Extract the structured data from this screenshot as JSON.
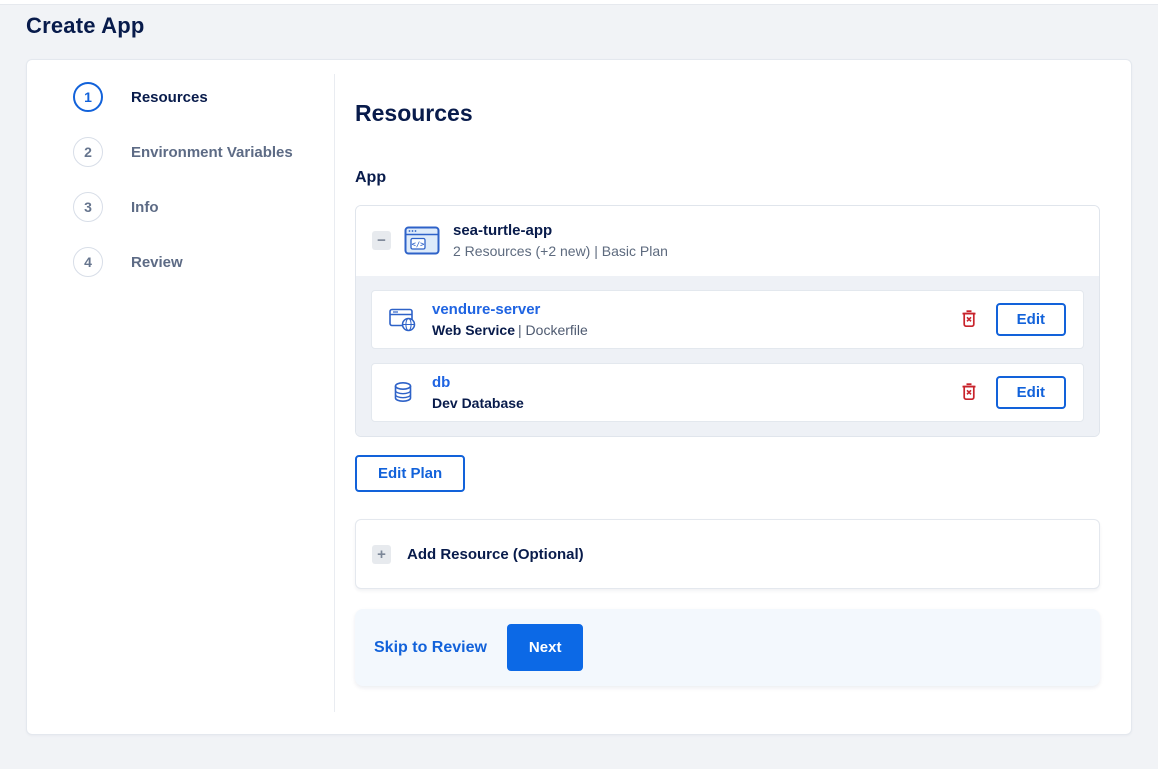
{
  "page": {
    "title": "Create App"
  },
  "stepper": {
    "active_step": 1,
    "steps": [
      {
        "number": "1",
        "label": "Resources"
      },
      {
        "number": "2",
        "label": "Environment Variables"
      },
      {
        "number": "3",
        "label": "Info"
      },
      {
        "number": "4",
        "label": "Review"
      }
    ]
  },
  "content": {
    "heading": "Resources",
    "app_section_label": "App",
    "app": {
      "name": "sea-turtle-app",
      "summary": "2 Resources (+2 new) | Basic Plan",
      "collapse_glyph": "−",
      "resources": [
        {
          "name": "vendure-server",
          "type": "Web Service",
          "detail": "| Dockerfile",
          "edit_label": "Edit"
        },
        {
          "name": "db",
          "type": "Dev Database",
          "detail": "",
          "edit_label": "Edit"
        }
      ]
    },
    "edit_plan_label": "Edit Plan",
    "add_resource": {
      "label": "Add Resource (Optional)",
      "plus_glyph": "+"
    },
    "footer": {
      "skip_label": "Skip to Review",
      "next_label": "Next"
    }
  },
  "colors": {
    "accent_blue": "#1262da",
    "primary_button_blue": "#0c69e6",
    "danger_red": "#c8232b",
    "navy_text": "#081b4b",
    "page_background": "#f1f3f6"
  }
}
